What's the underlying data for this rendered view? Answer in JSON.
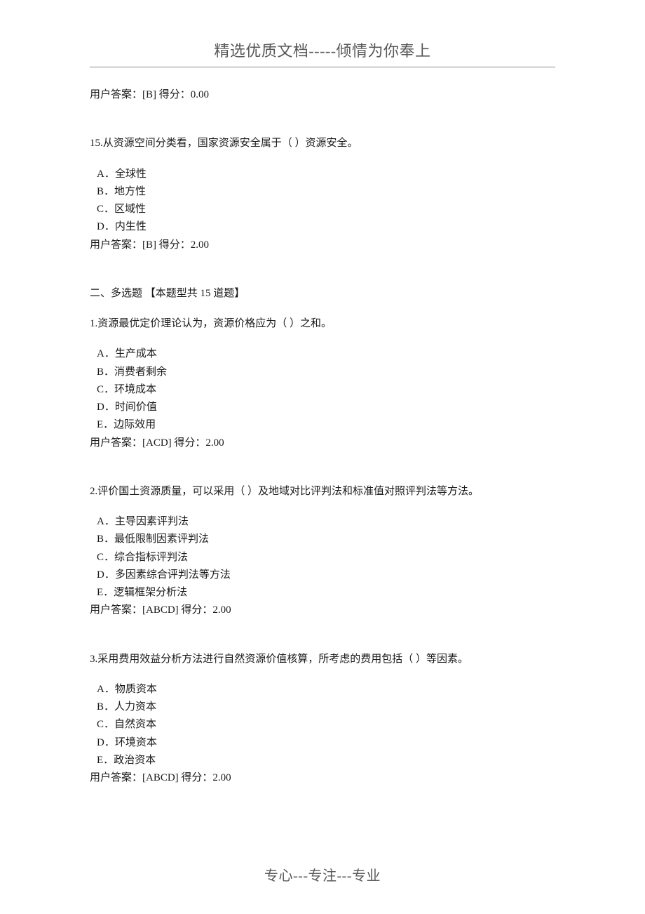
{
  "header": "精选优质文档-----倾情为你奉上",
  "footer": "专心---专注---专业",
  "prev_answer": "用户答案：[B]  得分：0.00",
  "q15": {
    "stem": "15.从资源空间分类看，国家资源安全属于（    ）资源安全。",
    "opts": {
      "a": "A．全球性",
      "b": "B．地方性",
      "c": "C．区域性",
      "d": "D．内生性"
    },
    "ans": "用户答案：[B]  得分：2.00"
  },
  "section2": "二、多选题 【本题型共 15 道题】",
  "m1": {
    "stem": "1.资源最优定价理论认为，资源价格应为（   ）之和。",
    "opts": {
      "a": "A．生产成本",
      "b": "B．消费者剩余",
      "c": "C．环境成本",
      "d": "D．时间价值",
      "e": "E．边际效用"
    },
    "ans": "用户答案：[ACD]  得分：2.00"
  },
  "m2": {
    "stem": "2.评价国土资源质量，可以采用（   ）及地域对比评判法和标准值对照评判法等方法。",
    "opts": {
      "a": "A．主导因素评判法",
      "b": "B．最低限制因素评判法",
      "c": "C．综合指标评判法",
      "d": "D．多因素综合评判法等方法",
      "e": "E．逻辑框架分析法"
    },
    "ans": "用户答案：[ABCD]  得分：2.00"
  },
  "m3": {
    "stem": "3.采用费用效益分析方法进行自然资源价值核算，所考虑的费用包括（    ）等因素。",
    "opts": {
      "a": "A．物质资本",
      "b": "B．人力资本",
      "c": "C．自然资本",
      "d": "D．环境资本",
      "e": "E．政治资本"
    },
    "ans": "用户答案：[ABCD]  得分：2.00"
  }
}
